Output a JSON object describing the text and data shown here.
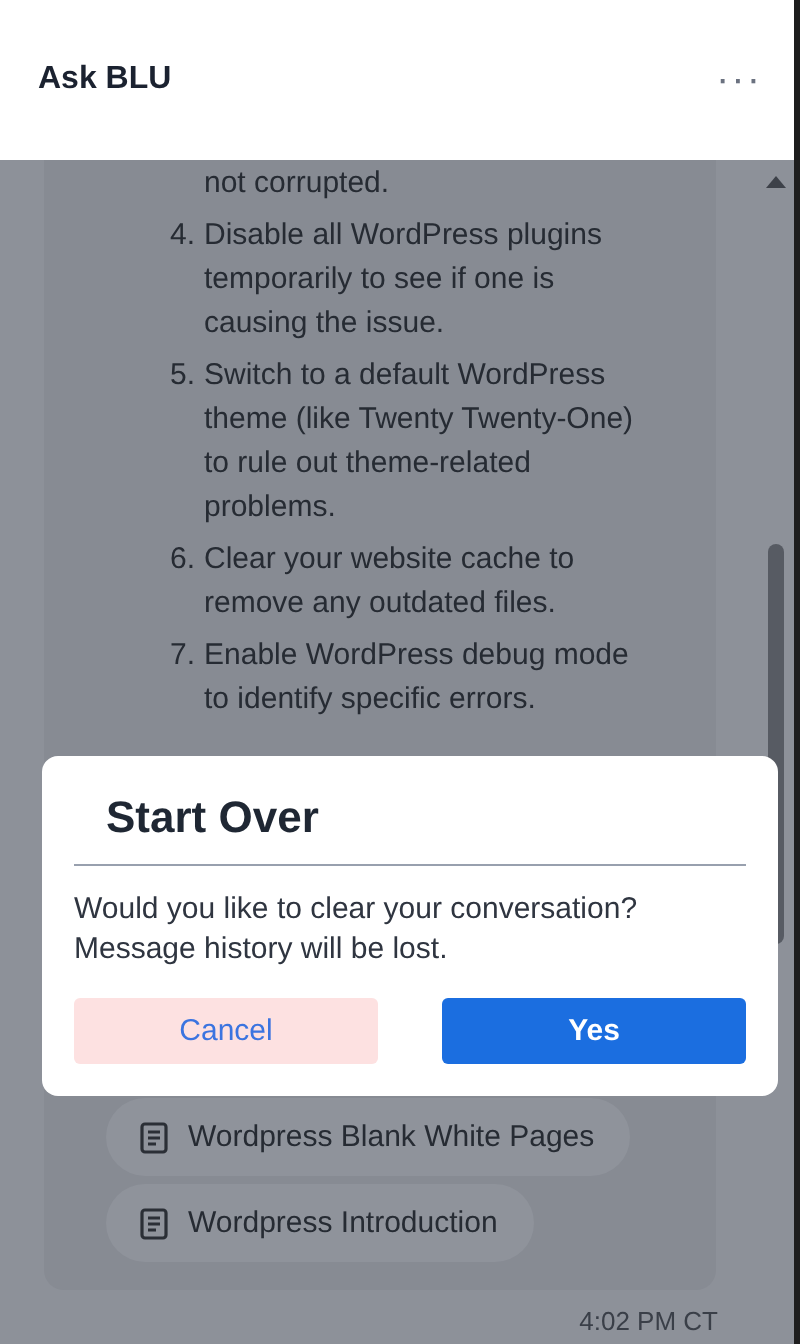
{
  "header": {
    "title": "Ask BLU",
    "menu": "···"
  },
  "steps": [
    {
      "text": "not corrupted."
    },
    {
      "number": "4.",
      "text": "Disable all WordPress plugins temporarily to see if one is causing the issue."
    },
    {
      "number": "5.",
      "text": "Switch to a default WordPress theme (like Twenty Twenty-One) to rule out theme-related problems."
    },
    {
      "number": "6.",
      "text": "Clear your website cache to remove any outdated files."
    },
    {
      "number": "7.",
      "text": "Enable WordPress debug mode to identify specific errors."
    }
  ],
  "articles": [
    {
      "label": "Wordpress Blank White Pages"
    },
    {
      "label": "Wordpress Introduction"
    }
  ],
  "timestamp": "4:02 PM CT",
  "dialog": {
    "title": "Start Over",
    "message": "Would you like to clear your conversation? Message history will be lost.",
    "buttons": [
      {
        "label": "Cancel",
        "kind": "secondary"
      },
      {
        "label": "Yes",
        "kind": "primary"
      }
    ]
  }
}
